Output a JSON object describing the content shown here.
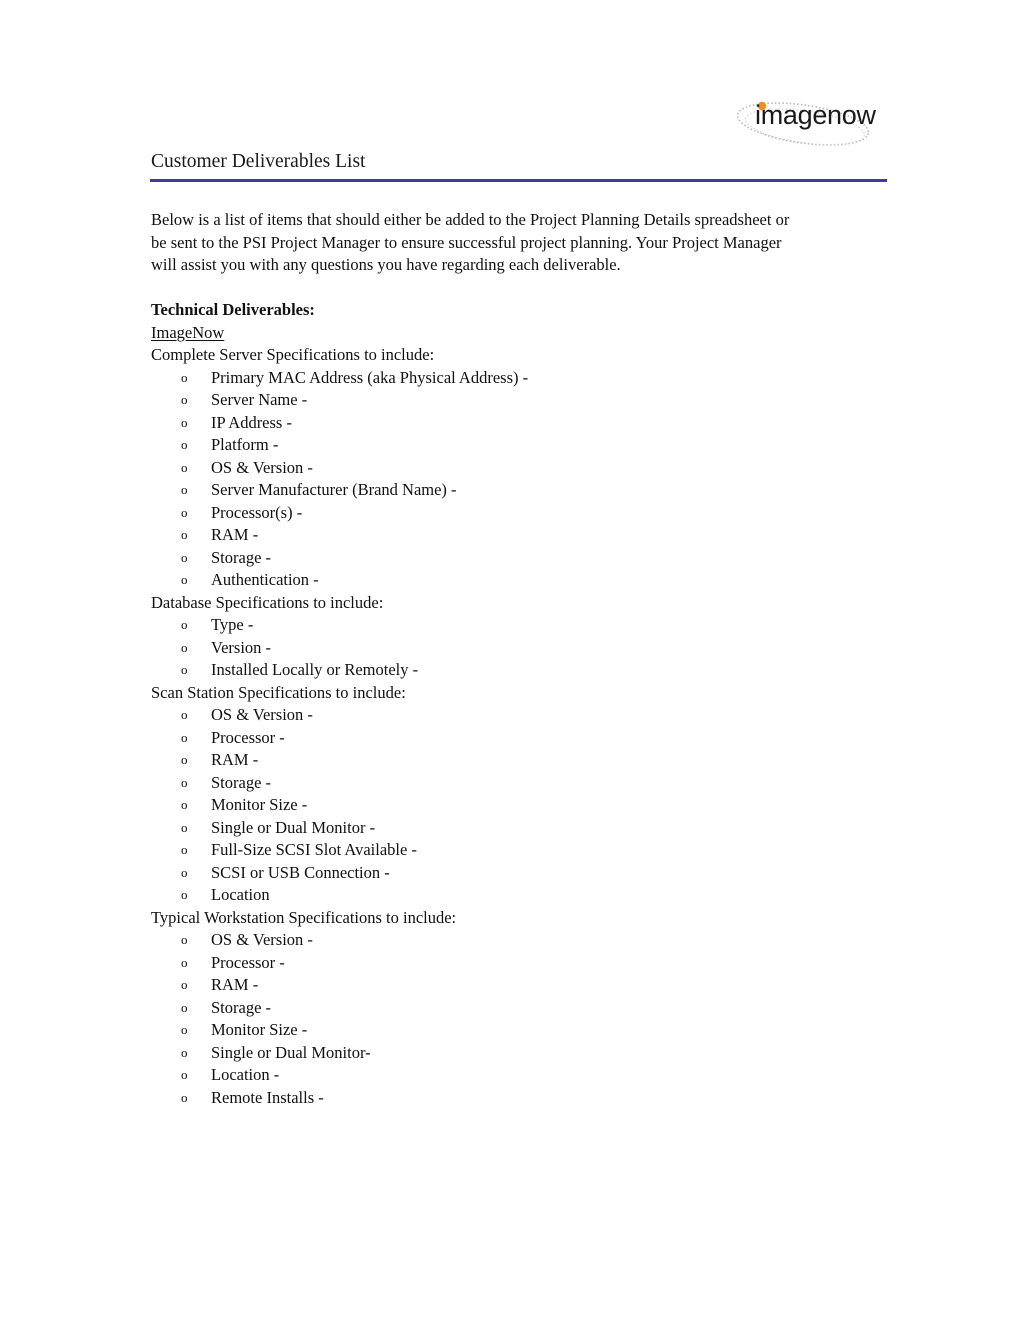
{
  "header": {
    "logo_text": "imagenow",
    "logo_accent_color": "#f28c1f",
    "title": "Customer Deliverables List",
    "rule_color": "#3b3ba2"
  },
  "intro": {
    "lines": [
      "Below is a list of items that should either be added to the Project Planning Details spreadsheet or",
      "be sent to the PSI Project Manager to ensure successful project planning.  Your Project Manager",
      "will assist you with any questions you have regarding each deliverable."
    ]
  },
  "technical": {
    "heading": "Technical Deliverables:",
    "subheading": "ImageNow",
    "bullet_glyph": "o",
    "sections": [
      {
        "label": "Complete Server Specifications to include:",
        "items": [
          "Primary MAC Address (aka Physical Address) -",
          "Server Name -",
          "IP Address -",
          "Platform -",
          "OS & Version -",
          "Server Manufacturer (Brand Name) -",
          "Processor(s) -",
          "RAM -",
          "Storage -",
          "Authentication -"
        ]
      },
      {
        "label": "Database Specifications to include:",
        "items": [
          "Type -",
          "Version -",
          "Installed Locally or Remotely -"
        ]
      },
      {
        "label": "Scan Station Specifications to include:",
        "items": [
          "OS & Version -",
          "Processor -",
          "RAM -",
          "Storage -",
          "Monitor Size -",
          "Single or Dual Monitor -",
          "Full-Size SCSI Slot Available -",
          "SCSI or USB Connection -",
          "Location"
        ]
      },
      {
        "label": "Typical Workstation Specifications to include:",
        "items": [
          "OS & Version -",
          "Processor -",
          "RAM -",
          "Storage -",
          "Monitor Size -",
          "Single or Dual Monitor-",
          "Location -",
          "Remote Installs -"
        ]
      }
    ]
  }
}
